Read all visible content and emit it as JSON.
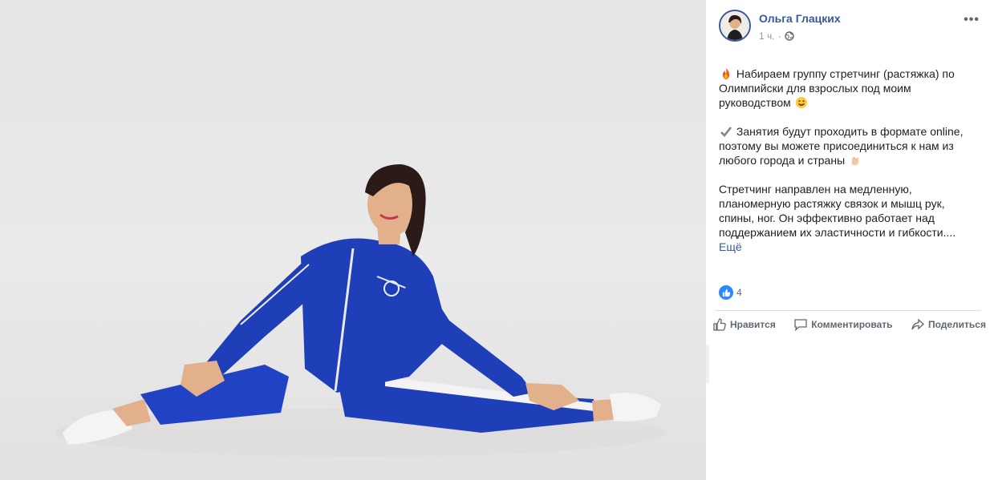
{
  "photo": {
    "subject_icon": "photo-woman-stretching",
    "background_color": "#e7e6e7"
  },
  "post": {
    "author": "Ольга Глацких",
    "time": "1 ч.",
    "audience_icon": "globe-icon",
    "paragraphs": [
      {
        "icon": "fire-emoji",
        "text": "Набираем группу стретчинг (растяжка) по Олимпийски для взрослых под моим руководством",
        "trailing_icon": "wink-emoji"
      },
      {
        "icon": "check-emoji",
        "text": "Занятия будут проходить в формате online, поэтому вы можете присоединиться к нам из любого города и страны",
        "trailing_icon": "clap-emoji"
      },
      {
        "text": "Стретчинг направлен на медленную, планомерную растяжку связок и мышц рук, спины, ног. Он эффективно работает над поддержанием их эластичности и гибкости...."
      }
    ],
    "see_more": "Ещё",
    "reactions_count": "4"
  },
  "actions": {
    "like": "Нравится",
    "comment": "Комментировать",
    "share": "Поделиться"
  },
  "colors": {
    "link": "#385898",
    "accent": "#2d88ff",
    "meta": "#90949c",
    "jacket": "#1f3fb8"
  }
}
